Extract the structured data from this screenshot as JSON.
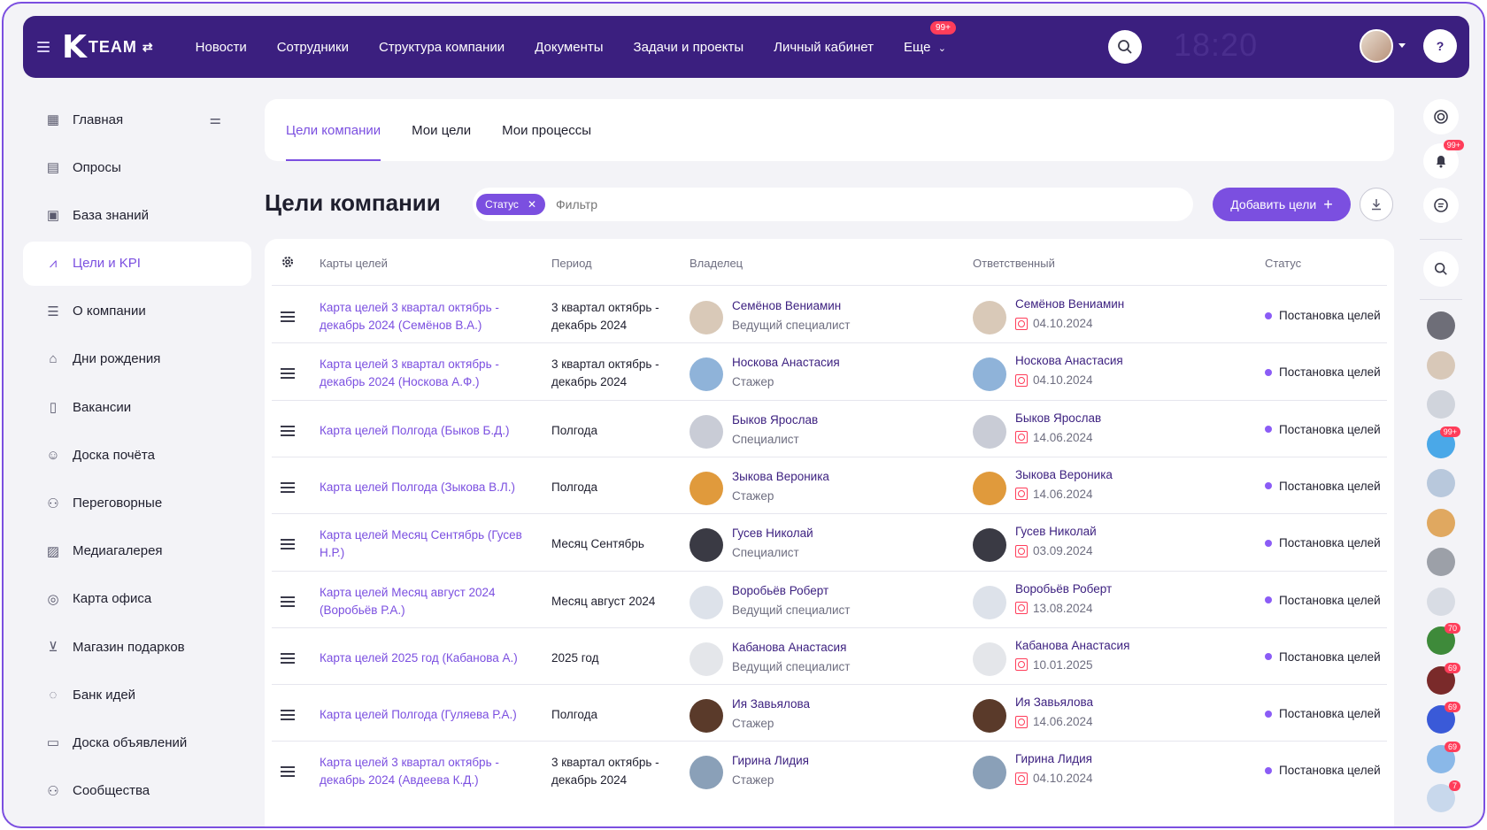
{
  "header": {
    "logo_k": "K",
    "logo_text": "TEAM",
    "nav": [
      "Новости",
      "Сотрудники",
      "Структура компании",
      "Документы",
      "Задачи и проекты",
      "Личный кабинет"
    ],
    "more_label": "Еще",
    "more_badge": "99+",
    "clock": "18:20"
  },
  "sidebar": {
    "items": [
      {
        "label": "Главная",
        "icon": "dashboard-icon"
      },
      {
        "label": "Опросы",
        "icon": "survey-icon"
      },
      {
        "label": "База знаний",
        "icon": "book-icon"
      },
      {
        "label": "Цели и KPI",
        "icon": "kpi-icon"
      },
      {
        "label": "О компании",
        "icon": "list-icon"
      },
      {
        "label": "Дни рождения",
        "icon": "cake-icon"
      },
      {
        "label": "Вакансии",
        "icon": "vacancy-icon"
      },
      {
        "label": "Доска почёта",
        "icon": "user-plus-icon"
      },
      {
        "label": "Переговорные",
        "icon": "meeting-icon"
      },
      {
        "label": "Медиагалерея",
        "icon": "gallery-icon"
      },
      {
        "label": "Карта офиса",
        "icon": "map-pin-icon"
      },
      {
        "label": "Магазин подарков",
        "icon": "cart-icon"
      },
      {
        "label": "Банк идей",
        "icon": "bulb-icon"
      },
      {
        "label": "Доска объявлений",
        "icon": "board-icon"
      },
      {
        "label": "Сообщества",
        "icon": "community-icon"
      }
    ],
    "active_index": 3
  },
  "tabs": [
    "Цели компании",
    "Мои цели",
    "Мои процессы"
  ],
  "page": {
    "title": "Цели компании",
    "chip_label": "Статус",
    "filter_placeholder": "Фильтр",
    "add_button": "Добавить цели"
  },
  "table": {
    "headers": {
      "cards": "Карты целей",
      "period": "Период",
      "owner": "Владелец",
      "responsible": "Ответственный",
      "status": "Статус"
    },
    "rows": [
      {
        "card": "Карта целей 3 квартал октябрь - декабрь 2024 (Семёнов В.А.)",
        "period": "3 квартал октябрь - декабрь 2024",
        "owner": "Семёнов Вениамин",
        "role": "Ведущий специалист",
        "responsible": "Семёнов Вениамин",
        "date": "04.10.2024",
        "status": "Постановка целей",
        "avatar_color": "#d9c9b8"
      },
      {
        "card": "Карта целей 3 квартал октябрь - декабрь 2024 (Носкова А.Ф.)",
        "period": "3 квартал октябрь - декабрь 2024",
        "owner": "Носкова Анастасия",
        "role": "Стажер",
        "responsible": "Носкова Анастасия",
        "date": "04.10.2024",
        "status": "Постановка целей",
        "avatar_color": "#8fb3d9"
      },
      {
        "card": "Карта целей Полгода (Быков Б.Д.)",
        "period": "Полгода",
        "owner": "Быков Ярослав",
        "role": "Специалист",
        "responsible": "Быков Ярослав",
        "date": "14.06.2024",
        "status": "Постановка целей",
        "avatar_color": "#c9ccd6"
      },
      {
        "card": "Карта целей Полгода (Зыкова В.Л.)",
        "period": "Полгода",
        "owner": "Зыкова Вероника",
        "role": "Стажер",
        "responsible": "Зыкова Вероника",
        "date": "14.06.2024",
        "status": "Постановка целей",
        "avatar_color": "#e09a3c"
      },
      {
        "card": "Карта целей Месяц Сентябрь (Гусев Н.Р.)",
        "period": "Месяц Сентябрь",
        "owner": "Гусев Николай",
        "role": "Специалист",
        "responsible": "Гусев Николай",
        "date": "03.09.2024",
        "status": "Постановка целей",
        "avatar_color": "#3a3a44"
      },
      {
        "card": "Карта целей Месяц август 2024 (Воробьёв Р.А.)",
        "period": "Месяц август 2024",
        "owner": "Воробьёв Роберт",
        "role": "Ведущий специалист",
        "responsible": "Воробьёв Роберт",
        "date": "13.08.2024",
        "status": "Постановка целей",
        "avatar_color": "#dde2ea"
      },
      {
        "card": "Карта целей 2025 год (Кабанова А.)",
        "period": "2025 год",
        "owner": "Кабанова Анастасия",
        "role": "Ведущий специалист",
        "responsible": "Кабанова Анастасия",
        "date": "10.01.2025",
        "status": "Постановка целей",
        "avatar_color": "#e4e6ea"
      },
      {
        "card": "Карта целей Полгода (Гуляева Р.А.)",
        "period": "Полгода",
        "owner": "Ия Завьялова",
        "role": "Стажер",
        "responsible": "Ия Завьялова",
        "date": "14.06.2024",
        "status": "Постановка целей",
        "avatar_color": "#5a3a2a"
      },
      {
        "card": "Карта целей 3 квартал октябрь - декабрь 2024 (Авдеева К.Д.)",
        "period": "3 квартал октябрь - декабрь 2024",
        "owner": "Гирина Лидия",
        "role": "Стажер",
        "responsible": "Гирина Лидия",
        "date": "04.10.2024",
        "status": "Постановка целей",
        "avatar_color": "#8aa0b8"
      }
    ]
  },
  "rail": {
    "bell_badge": "99+",
    "avatars": [
      {
        "color": "#6e6e78",
        "badge": ""
      },
      {
        "color": "#d8c8b8",
        "badge": ""
      },
      {
        "color": "#d0d4dc",
        "badge": ""
      },
      {
        "color": "#4aa8e8",
        "badge": "99+"
      },
      {
        "color": "#b8c8dc",
        "badge": ""
      },
      {
        "color": "#e0a860",
        "badge": ""
      },
      {
        "color": "#9ca0a8",
        "badge": ""
      },
      {
        "color": "#d8dce4",
        "badge": ""
      },
      {
        "color": "#3e8a3a",
        "badge": "70"
      },
      {
        "color": "#7a2a2a",
        "badge": "69"
      },
      {
        "color": "#3a5ad8",
        "badge": "69"
      },
      {
        "color": "#8ab8e8",
        "badge": "69"
      },
      {
        "color": "#c8d8ec",
        "badge": "7"
      }
    ]
  },
  "colors": {
    "accent": "#7b4fe0",
    "header": "#3b1f7f",
    "alert": "#ff3d5a"
  }
}
